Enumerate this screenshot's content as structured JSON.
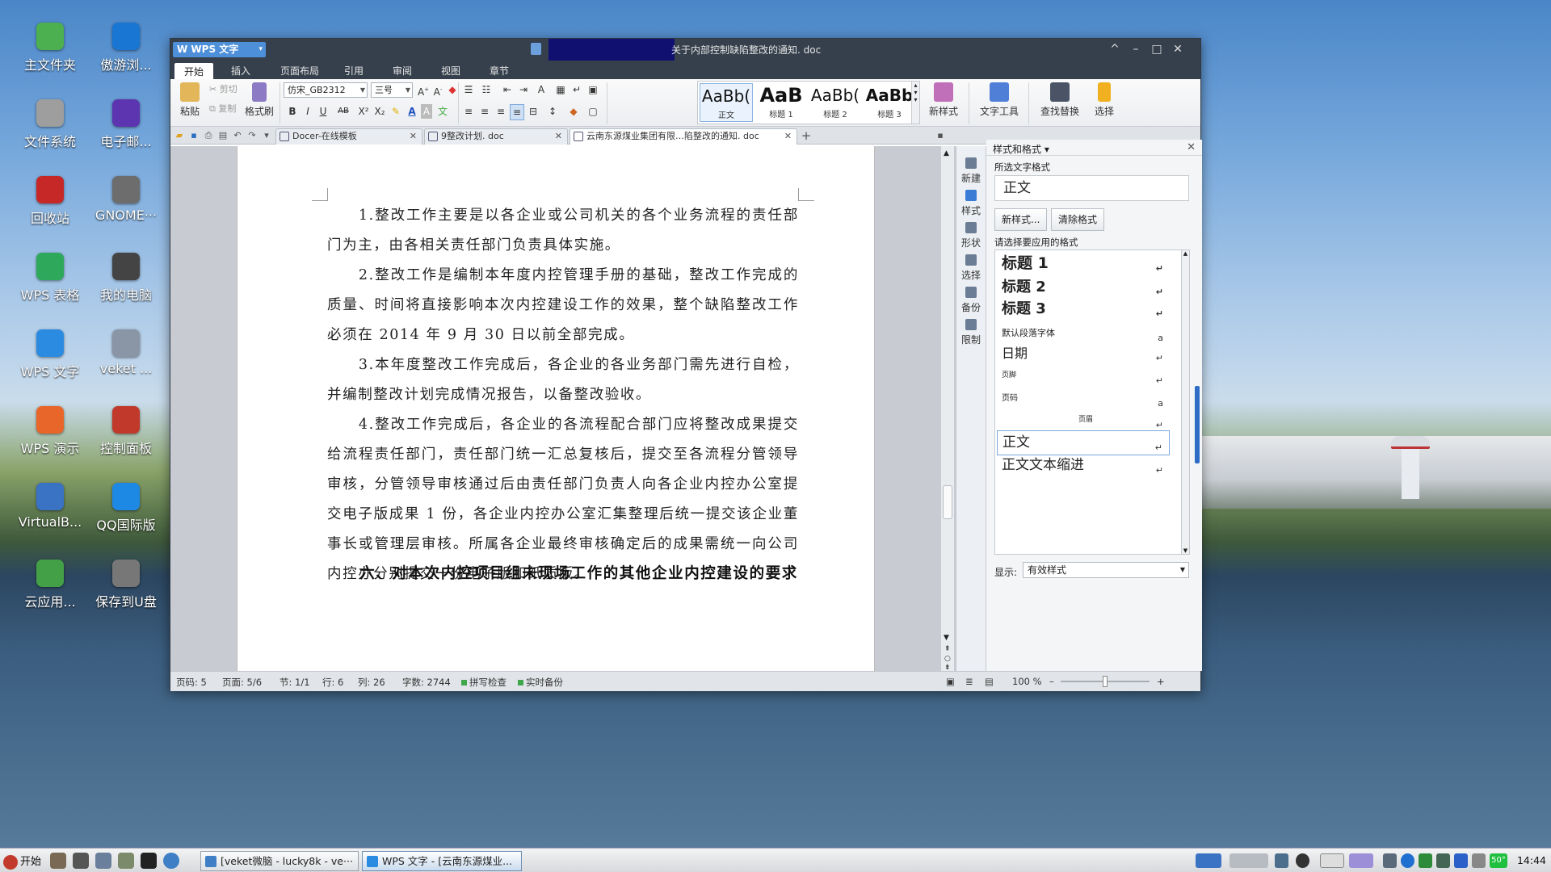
{
  "colors": {
    "accent": "#4d8fd8",
    "titlebar": "#35404c",
    "status_green": "#3fa64b"
  },
  "desktop": {
    "icons": [
      {
        "label": "主文件夹",
        "icon": "folder-icon",
        "color": "#4caf50"
      },
      {
        "label": "傲游浏...",
        "icon": "maxthon-browser-icon",
        "color": "#1976d2"
      },
      {
        "label": "文件系统",
        "icon": "harddisk-icon",
        "color": "#9e9e9e"
      },
      {
        "label": "电子邮...",
        "icon": "email-icon",
        "color": "#5e35b1"
      },
      {
        "label": "回收站",
        "icon": "trash-icon",
        "color": "#c62828"
      },
      {
        "label": "GNOME···",
        "icon": "gnome-app-icon",
        "color": "#6d6d6d"
      },
      {
        "label": "WPS 表格",
        "icon": "wps-spreadsheet-icon",
        "color": "#2ea85b"
      },
      {
        "label": "我的电脑",
        "icon": "computer-icon",
        "color": "#444444"
      },
      {
        "label": "WPS 文字",
        "icon": "wps-writer-icon",
        "color": "#2b8be0"
      },
      {
        "label": "veket ...",
        "icon": "veket-icon",
        "color": "#8a96a6"
      },
      {
        "label": "WPS 演示",
        "icon": "wps-presentation-icon",
        "color": "#e8662a"
      },
      {
        "label": "控制面板",
        "icon": "control-panel-icon",
        "color": "#c0392b"
      },
      {
        "label": "VirtualB...",
        "icon": "virtualbox-icon",
        "color": "#3a72c4"
      },
      {
        "label": "QQ国际版",
        "icon": "qq-icon",
        "color": "#1e88e5"
      },
      {
        "label": "云应用...",
        "icon": "cloud-app-icon",
        "color": "#43a047"
      },
      {
        "label": "保存到U盘",
        "icon": "usb-save-icon",
        "color": "#777777"
      }
    ]
  },
  "window": {
    "app_button": "WPS 文字",
    "title": "关于内部控制缺陷整改的通知. doc",
    "controls": [
      "^",
      "–",
      "□",
      "✕"
    ]
  },
  "menu": [
    "开始",
    "插入",
    "页面布局",
    "引用",
    "审阅",
    "视图",
    "章节"
  ],
  "ribbon": {
    "paste": "粘贴",
    "cut": "剪切",
    "copy": "复制",
    "format_painter": "格式刷",
    "font_name": "仿宋_GB2312",
    "font_size": "三号",
    "format_buttons": [
      "B",
      "I",
      "U",
      "AB",
      "X²",
      "X₂"
    ],
    "styles": [
      {
        "preview": "AaBb(",
        "label": "正文",
        "bold": false
      },
      {
        "preview": "AaB",
        "label": "标题 1",
        "bold": true
      },
      {
        "preview": "AaBb(",
        "label": "标题 2",
        "bold": false
      },
      {
        "preview": "AaBb",
        "label": "标题 3",
        "bold": true
      }
    ],
    "new_style": "新样式",
    "text_tools": "文字工具",
    "find_replace": "查找替换",
    "select": "选择"
  },
  "tabs": [
    {
      "label": "Docer-在线模板",
      "active": false
    },
    {
      "label": "9整改计划. doc",
      "active": false
    },
    {
      "label": "云南东源煤业集团有限…陷整改的通知. doc",
      "active": true
    }
  ],
  "document": {
    "paragraphs": [
      "　　1.整改工作主要是以各企业或公司机关的各个业务流程的责任部门为主，由各相关责任部门负责具体实施。",
      "　　2.整改工作是编制本年度内控管理手册的基础，整改工作完成的质量、时间将直接影响本次内控建设工作的效果，整个缺陷整改工作必须在 2014 年 9 月 30 日以前全部完成。",
      "　　3.本年度整改工作完成后，各企业的各业务部门需先进行自检，并编制整改计划完成情况报告，以备整改验收。",
      "　　4.整改工作完成后，各企业的各流程配合部门应将整改成果提交给流程责任部门，责任部门统一汇总复核后，提交至各流程分管领导审核，分管领导审核通过后由责任部门负责人向各企业内控办公室提交电子版成果 1 份，各企业内控办公室汇集整理后统一提交该企业董事长或管理层审核。所属各企业最终审核确定后的成果需统一向公司内控办分别提交一份电子版和纸质版。"
    ],
    "heading": "　　六、对本次内控项目组未现场工作的其他企业内控建设的要求"
  },
  "side_tools": [
    "新建",
    "样式",
    "形状",
    "选择",
    "备份",
    "限制"
  ],
  "styles_pane": {
    "title": "样式和格式 ▾",
    "selected_label": "所选文字格式",
    "selected_value": "正文",
    "new_style_btn": "新样式...",
    "clear_btn": "清除格式",
    "apply_label": "请选择要应用的格式",
    "items": [
      {
        "label": "标题 1",
        "kind": "h1"
      },
      {
        "label": "标题 2",
        "kind": "h2"
      },
      {
        "label": "标题 3",
        "kind": "h3"
      },
      {
        "label": "默认段落字体",
        "kind": "small"
      },
      {
        "label": "日期",
        "kind": "normal"
      },
      {
        "label": "页脚",
        "kind": "tiny"
      },
      {
        "label": "页码",
        "kind": "small"
      },
      {
        "label": "页眉",
        "kind": "center"
      },
      {
        "label": "正文",
        "kind": "normal",
        "selected": true
      },
      {
        "label": "正文文本缩进",
        "kind": "normal"
      }
    ],
    "show_label": "显示:",
    "show_value": "有效样式"
  },
  "status": {
    "page": "页码: 5",
    "pages": "页面: 5/6",
    "section": "节: 1/1",
    "row": "行: 6",
    "col": "列: 26",
    "words": "字数: 2744",
    "spell": "拼写检查",
    "backup": "实时备份",
    "zoom": "100 %",
    "zoom_level": 0.5
  },
  "taskbar": {
    "start": "开始",
    "tasks": [
      {
        "label": "[veket微脑 - lucky8k - ve···",
        "active": false
      },
      {
        "label": "WPS 文字 - [云南东源煤业...",
        "active": true
      }
    ],
    "battery": "50°",
    "clock": "14:44"
  }
}
